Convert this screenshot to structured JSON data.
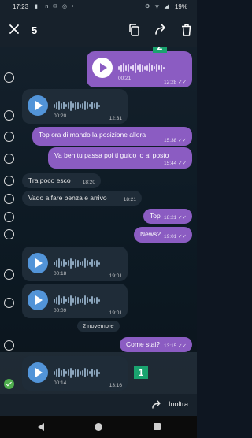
{
  "status_bar": {
    "time": "17:23",
    "notif_icons": "▮ in ✉ ◎ •",
    "system_icons": "⚙ ᯤ ◢",
    "battery": "19%"
  },
  "top_bar": {
    "selected_count": "5"
  },
  "messages": [
    {
      "type": "voice",
      "direction": "out",
      "duration": "00:21",
      "time": "12:28 ✓✓",
      "selected": false
    },
    {
      "type": "voice",
      "direction": "in",
      "duration": "00:20",
      "time": "12:31",
      "selected": false
    },
    {
      "type": "text",
      "direction": "out",
      "text": "Top ora di mando la posizione allora",
      "time": "15:38 ✓✓",
      "selected": false
    },
    {
      "type": "text",
      "direction": "out",
      "text": "Va beh tu passa poi ti guido io al posto",
      "time": "15:44 ✓✓",
      "selected": false
    },
    {
      "type": "text",
      "direction": "in",
      "text": "Tra poco esco",
      "time": "18:20",
      "selected": false
    },
    {
      "type": "text",
      "direction": "in",
      "text": "Vado a fare benza e arrivo",
      "time": "18:21",
      "selected": false
    },
    {
      "type": "text",
      "direction": "out",
      "text": "Top",
      "time": "18:21 ✓✓",
      "selected": false
    },
    {
      "type": "text",
      "direction": "out",
      "text": "News?",
      "time": "19:01 ✓✓",
      "selected": false
    },
    {
      "type": "voice",
      "direction": "in",
      "duration": "00:18",
      "time": "19:01",
      "selected": false
    },
    {
      "type": "voice",
      "direction": "in",
      "duration": "00:09",
      "time": "19:01",
      "selected": false
    },
    {
      "type": "text",
      "direction": "out",
      "text": "Come stai?",
      "time": "13:15 ✓✓",
      "selected": false
    },
    {
      "type": "voice",
      "direction": "in",
      "duration": "00:14",
      "time": "13:16",
      "selected": true
    }
  ],
  "date_separator": "2 novembre",
  "badges": {
    "first": "1",
    "second": "2"
  },
  "bottom_bar": {
    "forward_label": "Inoltra"
  },
  "colors": {
    "outgoing": "#8b5cc2",
    "incoming": "#1f2c38",
    "badge": "#1aa36f",
    "check": "#4fae4e"
  }
}
